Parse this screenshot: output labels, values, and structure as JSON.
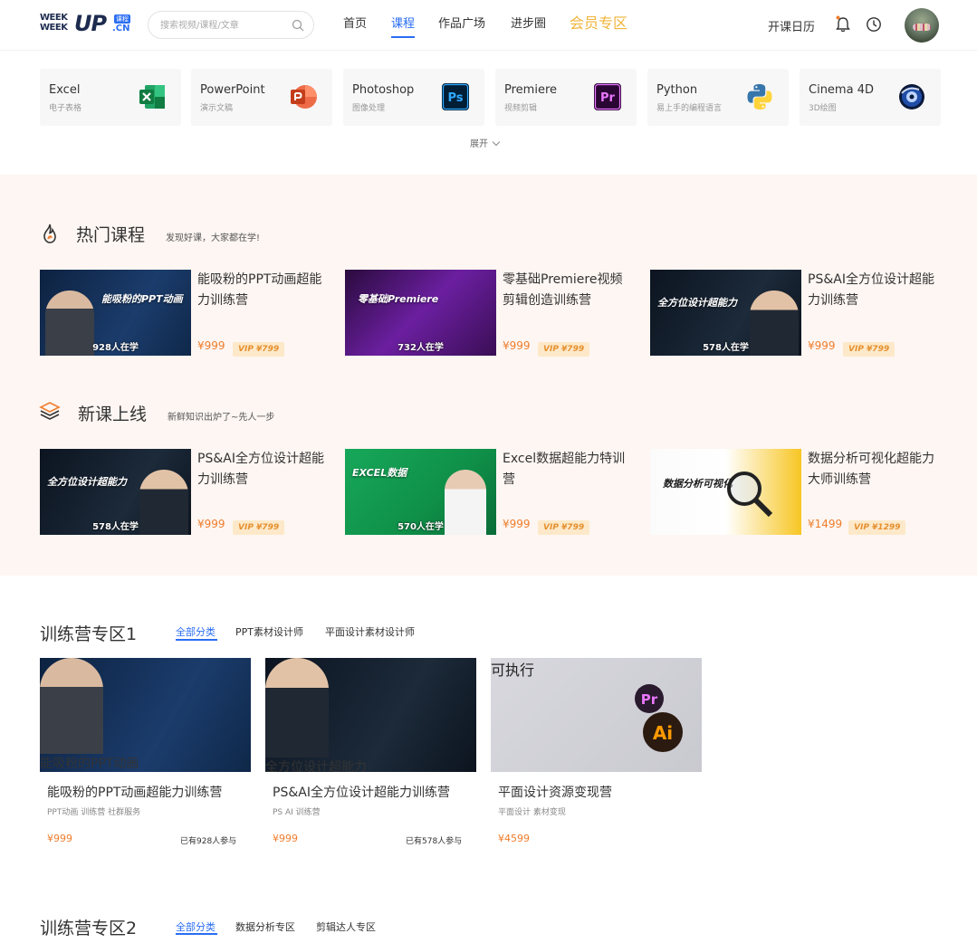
{
  "header": {
    "logo": {
      "line1": "WEEK",
      "line2": "WEEK",
      "up": "UP",
      "badge": "课程",
      "cn": ".CN"
    },
    "search": {
      "placeholder": "搜索视频/课程/文章"
    },
    "nav": [
      {
        "label": "首页",
        "active": false
      },
      {
        "label": "课程",
        "active": true
      },
      {
        "label": "作品广场",
        "active": false
      },
      {
        "label": "进步圈",
        "active": false
      },
      {
        "label": "会员专区",
        "active": false
      }
    ],
    "calendar_label": "开课日历",
    "colors": {
      "accent": "#2a6df4",
      "vip": "#f0b43a",
      "price": "#ef7d2d"
    }
  },
  "categories": [
    {
      "name": "Excel",
      "sub": "电子表格",
      "icon": "excel-icon"
    },
    {
      "name": "PowerPoint",
      "sub": "演示文稿",
      "icon": "powerpoint-icon"
    },
    {
      "name": "Photoshop",
      "sub": "图像处理",
      "icon": "photoshop-icon"
    },
    {
      "name": "Premiere",
      "sub": "视频剪辑",
      "icon": "premiere-icon"
    },
    {
      "name": "Python",
      "sub": "易上手的编程语言",
      "icon": "python-icon"
    },
    {
      "name": "Cinema 4D",
      "sub": "3D绘图",
      "icon": "cinema4d-icon"
    }
  ],
  "expand_label": "展开",
  "hot": {
    "title": "热门课程",
    "sub": "发现好课，大家都在学!",
    "courses": [
      {
        "title": "能吸粉的PPT动画超能力训练营",
        "price": "¥999",
        "vip": "VIP ¥799",
        "count": "928人在学",
        "thumb_text": "能吸粉的PPT动画"
      },
      {
        "title": "零基础Premiere视频剪辑创造训练营",
        "price": "¥999",
        "vip": "VIP ¥799",
        "count": "732人在学",
        "thumb_text": "零基础Premiere"
      },
      {
        "title": "PS&AI全方位设计超能力训练营",
        "price": "¥999",
        "vip": "VIP ¥799",
        "count": "578人在学",
        "thumb_text": "全方位设计超能力"
      }
    ]
  },
  "new": {
    "title": "新课上线",
    "sub": "新鲜知识出炉了~先人一步",
    "courses": [
      {
        "title": "PS&AI全方位设计超能力训练营",
        "price": "¥999",
        "vip": "VIP ¥799",
        "count": "578人在学",
        "thumb_text": "全方位设计超能力"
      },
      {
        "title": "Excel数据超能力特训营",
        "price": "¥999",
        "vip": "VIP ¥799",
        "count": "570人在学",
        "thumb_text": "EXCEL数据"
      },
      {
        "title": "数据分析可视化超能力大师训练营",
        "price": "¥1499",
        "vip": "VIP ¥1299",
        "count": "",
        "thumb_text": "数据分析可视化"
      }
    ]
  },
  "zone1": {
    "title": "训练营专区1",
    "tabs": [
      "全部分类",
      "PPT素材设计师",
      "平面设计素材设计师"
    ],
    "cards": [
      {
        "title": "能吸粉的PPT动画超能力训练营",
        "tags": "PPT动画  训练营  社群服务",
        "price": "¥999",
        "join": "已有928人参与",
        "thumb_text": "能吸粉的PPT动画"
      },
      {
        "title": "PS&AI全方位设计超能力训练营",
        "tags": "PS  AI  训练营",
        "price": "¥999",
        "join": "已有578人参与",
        "thumb_text": "全方位设计超能力"
      },
      {
        "title": "平面设计资源变现营",
        "tags": "平面设计  素材变现",
        "price": "¥4599",
        "join": "",
        "thumb_text": "可执行"
      }
    ]
  },
  "zone2": {
    "title": "训练营专区2",
    "tabs": [
      "全部分类",
      "数据分析专区",
      "剪辑达人专区"
    ]
  }
}
